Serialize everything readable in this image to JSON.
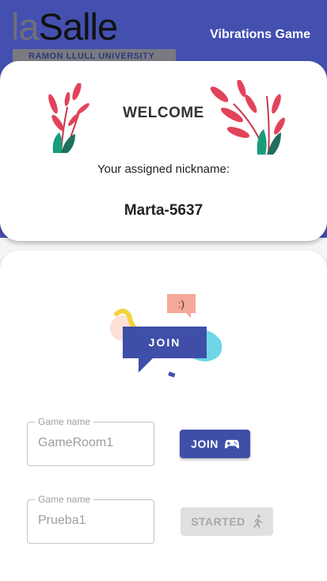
{
  "header": {
    "logo_la": "la",
    "logo_salle": "Salle",
    "logo_subtitle": "RAMON LLULL UNIVERSITY",
    "app_title": "Vibrations Game"
  },
  "welcome": {
    "title": "WELCOME",
    "nickname_label": "Your assigned nickname:",
    "nickname": "Marta-5637"
  },
  "join_illustration": {
    "label": "JOIN",
    "emoticon": ":)"
  },
  "games": [
    {
      "field_label": "Game name",
      "field_value": "GameRoom1",
      "button_label": "JOIN",
      "button_icon": "gamepad-icon",
      "button_state": "enabled"
    },
    {
      "field_label": "Game name",
      "field_value": "Prueba1",
      "button_label": "STARTED",
      "button_icon": "running-person-icon",
      "button_state": "disabled"
    }
  ],
  "colors": {
    "primary": "#4450b0",
    "button_join": "#3f4fa8",
    "button_disabled": "#e0e0e0",
    "accent_red": "#e2435a",
    "accent_green": "#1a9c7a"
  }
}
